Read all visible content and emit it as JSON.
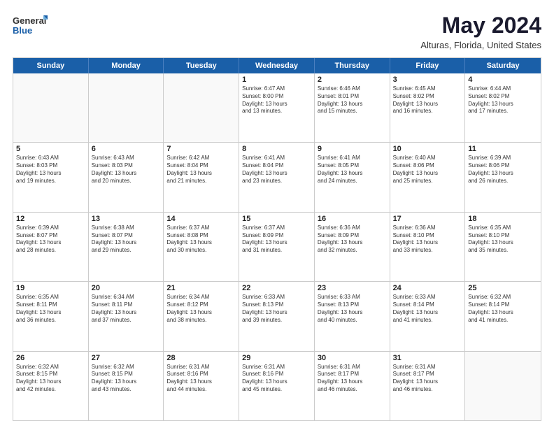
{
  "logo": {
    "general": "General",
    "blue": "Blue"
  },
  "title": "May 2024",
  "subtitle": "Alturas, Florida, United States",
  "days_of_week": [
    "Sunday",
    "Monday",
    "Tuesday",
    "Wednesday",
    "Thursday",
    "Friday",
    "Saturday"
  ],
  "weeks": [
    [
      {
        "day": "",
        "empty": true
      },
      {
        "day": "",
        "empty": true
      },
      {
        "day": "",
        "empty": true
      },
      {
        "day": "1",
        "lines": [
          "Sunrise: 6:47 AM",
          "Sunset: 8:00 PM",
          "Daylight: 13 hours",
          "and 13 minutes."
        ]
      },
      {
        "day": "2",
        "lines": [
          "Sunrise: 6:46 AM",
          "Sunset: 8:01 PM",
          "Daylight: 13 hours",
          "and 15 minutes."
        ]
      },
      {
        "day": "3",
        "lines": [
          "Sunrise: 6:45 AM",
          "Sunset: 8:02 PM",
          "Daylight: 13 hours",
          "and 16 minutes."
        ]
      },
      {
        "day": "4",
        "lines": [
          "Sunrise: 6:44 AM",
          "Sunset: 8:02 PM",
          "Daylight: 13 hours",
          "and 17 minutes."
        ]
      }
    ],
    [
      {
        "day": "5",
        "lines": [
          "Sunrise: 6:43 AM",
          "Sunset: 8:03 PM",
          "Daylight: 13 hours",
          "and 19 minutes."
        ]
      },
      {
        "day": "6",
        "lines": [
          "Sunrise: 6:43 AM",
          "Sunset: 8:03 PM",
          "Daylight: 13 hours",
          "and 20 minutes."
        ]
      },
      {
        "day": "7",
        "lines": [
          "Sunrise: 6:42 AM",
          "Sunset: 8:04 PM",
          "Daylight: 13 hours",
          "and 21 minutes."
        ]
      },
      {
        "day": "8",
        "lines": [
          "Sunrise: 6:41 AM",
          "Sunset: 8:04 PM",
          "Daylight: 13 hours",
          "and 23 minutes."
        ]
      },
      {
        "day": "9",
        "lines": [
          "Sunrise: 6:41 AM",
          "Sunset: 8:05 PM",
          "Daylight: 13 hours",
          "and 24 minutes."
        ]
      },
      {
        "day": "10",
        "lines": [
          "Sunrise: 6:40 AM",
          "Sunset: 8:06 PM",
          "Daylight: 13 hours",
          "and 25 minutes."
        ]
      },
      {
        "day": "11",
        "lines": [
          "Sunrise: 6:39 AM",
          "Sunset: 8:06 PM",
          "Daylight: 13 hours",
          "and 26 minutes."
        ]
      }
    ],
    [
      {
        "day": "12",
        "lines": [
          "Sunrise: 6:39 AM",
          "Sunset: 8:07 PM",
          "Daylight: 13 hours",
          "and 28 minutes."
        ]
      },
      {
        "day": "13",
        "lines": [
          "Sunrise: 6:38 AM",
          "Sunset: 8:07 PM",
          "Daylight: 13 hours",
          "and 29 minutes."
        ]
      },
      {
        "day": "14",
        "lines": [
          "Sunrise: 6:37 AM",
          "Sunset: 8:08 PM",
          "Daylight: 13 hours",
          "and 30 minutes."
        ]
      },
      {
        "day": "15",
        "lines": [
          "Sunrise: 6:37 AM",
          "Sunset: 8:09 PM",
          "Daylight: 13 hours",
          "and 31 minutes."
        ]
      },
      {
        "day": "16",
        "lines": [
          "Sunrise: 6:36 AM",
          "Sunset: 8:09 PM",
          "Daylight: 13 hours",
          "and 32 minutes."
        ]
      },
      {
        "day": "17",
        "lines": [
          "Sunrise: 6:36 AM",
          "Sunset: 8:10 PM",
          "Daylight: 13 hours",
          "and 33 minutes."
        ]
      },
      {
        "day": "18",
        "lines": [
          "Sunrise: 6:35 AM",
          "Sunset: 8:10 PM",
          "Daylight: 13 hours",
          "and 35 minutes."
        ]
      }
    ],
    [
      {
        "day": "19",
        "lines": [
          "Sunrise: 6:35 AM",
          "Sunset: 8:11 PM",
          "Daylight: 13 hours",
          "and 36 minutes."
        ]
      },
      {
        "day": "20",
        "lines": [
          "Sunrise: 6:34 AM",
          "Sunset: 8:11 PM",
          "Daylight: 13 hours",
          "and 37 minutes."
        ]
      },
      {
        "day": "21",
        "lines": [
          "Sunrise: 6:34 AM",
          "Sunset: 8:12 PM",
          "Daylight: 13 hours",
          "and 38 minutes."
        ]
      },
      {
        "day": "22",
        "lines": [
          "Sunrise: 6:33 AM",
          "Sunset: 8:13 PM",
          "Daylight: 13 hours",
          "and 39 minutes."
        ]
      },
      {
        "day": "23",
        "lines": [
          "Sunrise: 6:33 AM",
          "Sunset: 8:13 PM",
          "Daylight: 13 hours",
          "and 40 minutes."
        ]
      },
      {
        "day": "24",
        "lines": [
          "Sunrise: 6:33 AM",
          "Sunset: 8:14 PM",
          "Daylight: 13 hours",
          "and 41 minutes."
        ]
      },
      {
        "day": "25",
        "lines": [
          "Sunrise: 6:32 AM",
          "Sunset: 8:14 PM",
          "Daylight: 13 hours",
          "and 41 minutes."
        ]
      }
    ],
    [
      {
        "day": "26",
        "lines": [
          "Sunrise: 6:32 AM",
          "Sunset: 8:15 PM",
          "Daylight: 13 hours",
          "and 42 minutes."
        ]
      },
      {
        "day": "27",
        "lines": [
          "Sunrise: 6:32 AM",
          "Sunset: 8:15 PM",
          "Daylight: 13 hours",
          "and 43 minutes."
        ]
      },
      {
        "day": "28",
        "lines": [
          "Sunrise: 6:31 AM",
          "Sunset: 8:16 PM",
          "Daylight: 13 hours",
          "and 44 minutes."
        ]
      },
      {
        "day": "29",
        "lines": [
          "Sunrise: 6:31 AM",
          "Sunset: 8:16 PM",
          "Daylight: 13 hours",
          "and 45 minutes."
        ]
      },
      {
        "day": "30",
        "lines": [
          "Sunrise: 6:31 AM",
          "Sunset: 8:17 PM",
          "Daylight: 13 hours",
          "and 46 minutes."
        ]
      },
      {
        "day": "31",
        "lines": [
          "Sunrise: 6:31 AM",
          "Sunset: 8:17 PM",
          "Daylight: 13 hours",
          "and 46 minutes."
        ]
      },
      {
        "day": "",
        "empty": true
      }
    ]
  ]
}
